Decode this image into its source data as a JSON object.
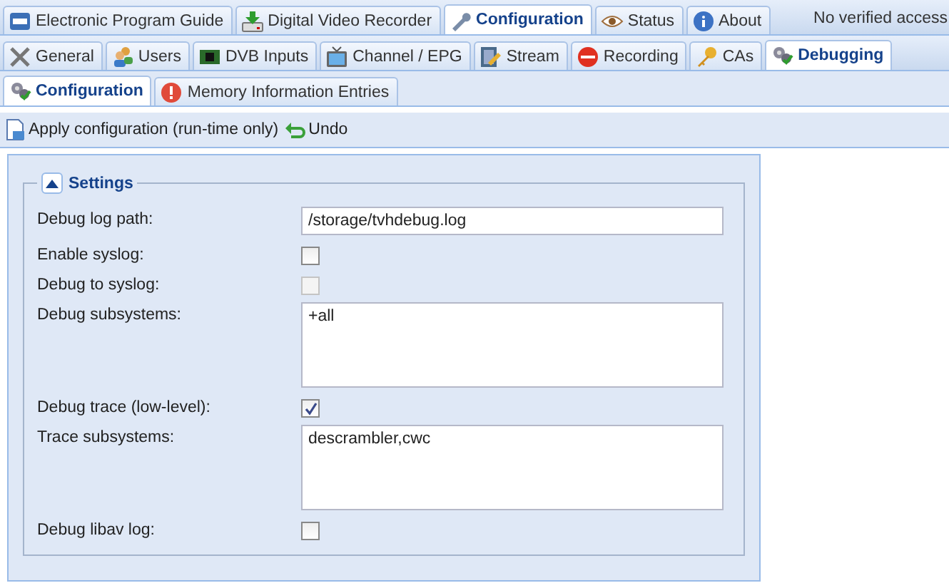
{
  "main_tabs": [
    {
      "label": "Electronic Program Guide",
      "selected": false
    },
    {
      "label": "Digital Video Recorder",
      "selected": false
    },
    {
      "label": "Configuration",
      "selected": true
    },
    {
      "label": "Status",
      "selected": false
    },
    {
      "label": "About",
      "selected": false
    }
  ],
  "access_status": "No verified access",
  "config_tabs": [
    {
      "label": "General",
      "selected": false
    },
    {
      "label": "Users",
      "selected": false
    },
    {
      "label": "DVB Inputs",
      "selected": false
    },
    {
      "label": "Channel / EPG",
      "selected": false
    },
    {
      "label": "Stream",
      "selected": false
    },
    {
      "label": "Recording",
      "selected": false
    },
    {
      "label": "CAs",
      "selected": false
    },
    {
      "label": "Debugging",
      "selected": true
    }
  ],
  "debug_tabs": [
    {
      "label": "Configuration",
      "selected": true
    },
    {
      "label": "Memory Information Entries",
      "selected": false
    }
  ],
  "toolbar": [
    {
      "label": "Apply configuration (run-time only)"
    },
    {
      "label": "Undo"
    }
  ],
  "settings": {
    "title": "Settings",
    "expanded": true,
    "fields": [
      {
        "kind": "text",
        "label": "Debug log path:",
        "value": "/storage/tvhdebug.log"
      },
      {
        "kind": "checkbox",
        "label": "Enable syslog:",
        "checked": false,
        "disabled": false
      },
      {
        "kind": "checkbox",
        "label": "Debug to syslog:",
        "checked": false,
        "disabled": true
      },
      {
        "kind": "textarea",
        "label": "Debug subsystems:",
        "value": "+all"
      },
      {
        "kind": "checkbox",
        "label": "Debug trace (low-level):",
        "checked": true,
        "disabled": false
      },
      {
        "kind": "textarea",
        "label": "Trace subsystems:",
        "value": "descrambler,cwc"
      },
      {
        "kind": "checkbox",
        "label": "Debug libav log:",
        "checked": false,
        "disabled": false
      }
    ]
  }
}
